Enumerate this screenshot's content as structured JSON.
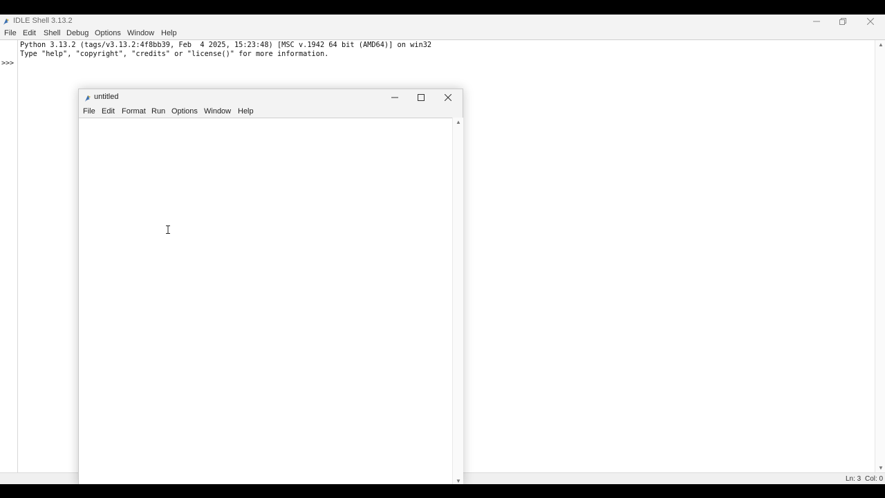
{
  "shell": {
    "title": "IDLE Shell 3.13.2",
    "menu": [
      "File",
      "Edit",
      "Shell",
      "Debug",
      "Options",
      "Window",
      "Help"
    ],
    "banner_line1": "Python 3.13.2 (tags/v3.13.2:4f8bb39, Feb  4 2025, 15:23:48) [MSC v.1942 64 bit (AMD64)] on win32",
    "banner_line2": "Type \"help\", \"copyright\", \"credits\" or \"license()\" for more information.",
    "prompt": ">>>",
    "status": {
      "line": "Ln: 3",
      "col": "Col: 0"
    }
  },
  "editor": {
    "title": "untitled",
    "menu": [
      "File",
      "Edit",
      "Format",
      "Run",
      "Options",
      "Window",
      "Help"
    ]
  },
  "icons": {
    "app": "python-feather-icon",
    "minimize": "minimize-icon",
    "maximize": "maximize-icon",
    "restore": "restore-icon",
    "close": "close-icon"
  }
}
